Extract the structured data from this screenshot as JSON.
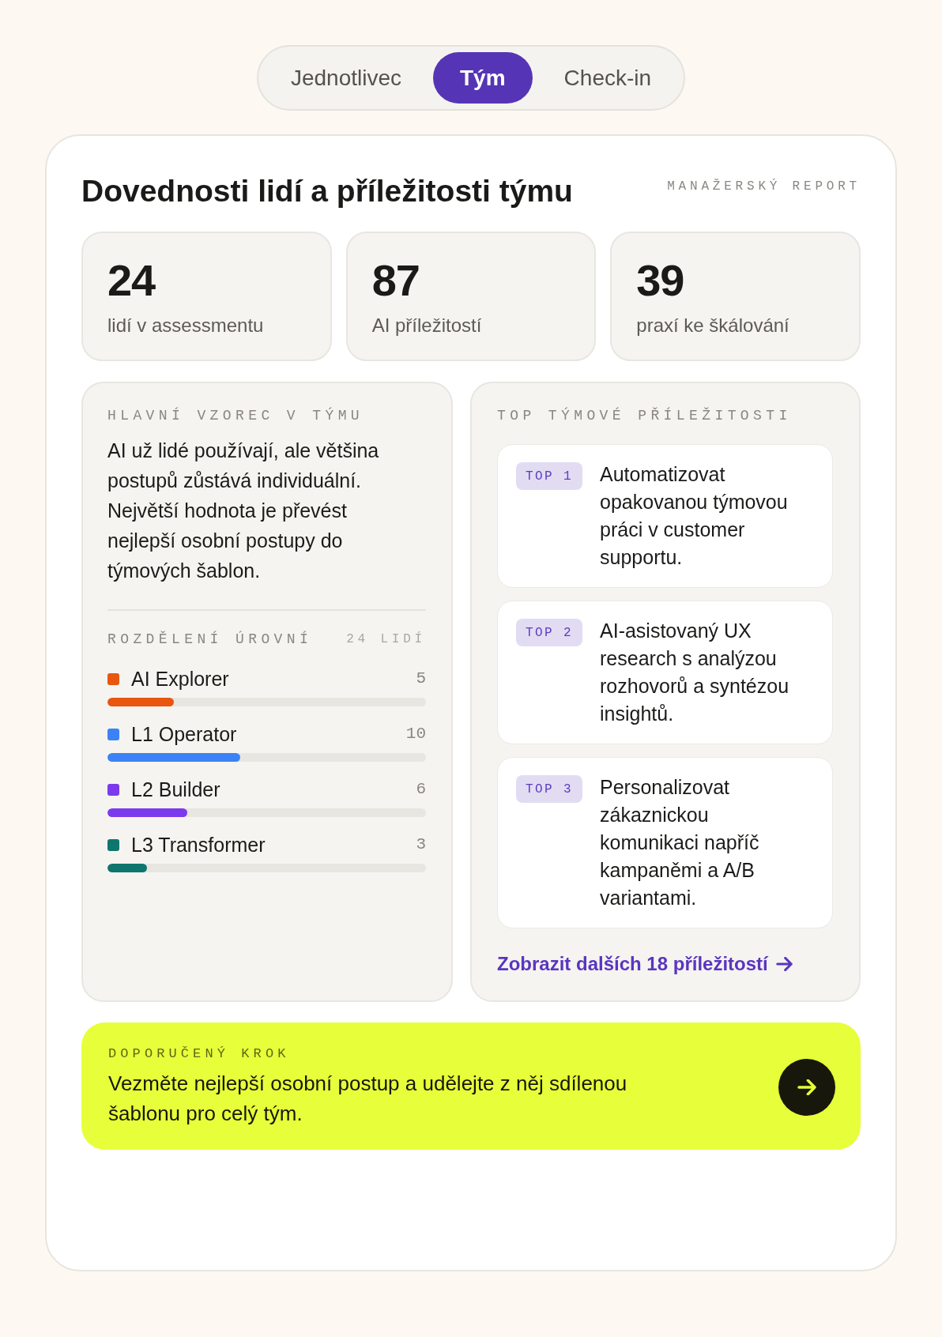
{
  "tabs": [
    {
      "label": "Jednotlivec",
      "selected": false
    },
    {
      "label": "Tým",
      "selected": true
    },
    {
      "label": "Check-in",
      "selected": false
    }
  ],
  "report": {
    "title": "Dovednosti lidí a příležitosti týmu",
    "tag": "MANAŽERSKÝ REPORT"
  },
  "stats": [
    {
      "value": "24",
      "label": "lidí v assessmentu"
    },
    {
      "value": "87",
      "label": "AI příležitostí"
    },
    {
      "value": "39",
      "label": "praxí ke škálování"
    }
  ],
  "pattern_panel": {
    "heading": "HLAVNÍ VZOREC V TÝMU",
    "text": "AI už lidé používají, ale většina postupů zůstává individuální. Největší hodnota je převést nejlepší osobní postupy do týmových šablon.",
    "distribution": {
      "heading": "ROZDĚLENÍ ÚROVNÍ",
      "total": "24 LIDÍ",
      "levels": [
        {
          "name": "AI Explorer",
          "count": "5",
          "color": "#e8560f",
          "level": 0.208
        },
        {
          "name": "L1 Operator",
          "count": "10",
          "color": "#3b82f6",
          "level": 0.417
        },
        {
          "name": "L2 Builder",
          "count": "6",
          "color": "#7c3aed",
          "level": 0.25
        },
        {
          "name": "L3 Transformer",
          "count": "3",
          "color": "#0f766e",
          "level": 0.125
        }
      ]
    }
  },
  "opportunities_panel": {
    "heading": "TOP TÝMOVÉ PŘÍLEŽITOSTI",
    "items": [
      {
        "badge": "TOP 1",
        "text": "Automatizovat opakovanou týmovou práci v customer supportu."
      },
      {
        "badge": "TOP 2",
        "text": "AI-asistovaný UX research s analýzou rozhovorů a syntézou insightů."
      },
      {
        "badge": "TOP 3",
        "text": "Personalizovat zákaznickou komunikaci napříč kampaněmi a A/B variantami."
      }
    ],
    "link": "Zobrazit dalších 18 příležitostí"
  },
  "recommendation": {
    "label": "DOPORUČENÝ KROK",
    "text": "Vezměte nejlepší osobní postup a udělejte z něj sdílenou šablonu pro celý tým."
  }
}
